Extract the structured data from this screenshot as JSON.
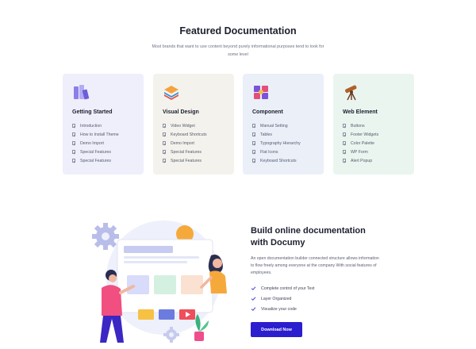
{
  "section": {
    "title": "Featured Documentation",
    "subtitle": "Most brands that want to use content beyond purely informational purposes tend to look for some level"
  },
  "cards": [
    {
      "title": "Getting Started",
      "icon": "book-stack-icon",
      "bg": "#efeefb",
      "items": [
        "Introduction",
        "How to Install Theme",
        "Demo Import",
        "Special Features",
        "Special Features"
      ]
    },
    {
      "title": "Visual Design",
      "icon": "layers-icon",
      "bg": "#f4f2ec",
      "items": [
        "Video Widget",
        "Keyboard Shortcuts",
        "Demo Import",
        "Special Features",
        "Special Features"
      ]
    },
    {
      "title": "Component",
      "icon": "cube-blocks-icon",
      "bg": "#eaeff8",
      "items": [
        "Manual Setting",
        "Tables",
        "Typography Hierarchy",
        "Flat Icons",
        "Keyboard Shortcuts"
      ]
    },
    {
      "title": "Web Element",
      "icon": "telescope-icon",
      "bg": "#eaf5ef",
      "items": [
        "Buttons",
        "Footer Widgets",
        "Color Palette",
        "WP Form",
        "Alert Popup"
      ]
    }
  ],
  "build": {
    "title_line1": "Build online documentation",
    "title_line2": "with Documy",
    "description": "An open documentation builder connected structure allows information to flow freely among everyone at the company With social features of employees.",
    "features": [
      "Complete control of your Text",
      "Layer Organized",
      "Visualize your code"
    ],
    "button_label": "Download Now"
  },
  "colors": {
    "accent": "#2b1ecf",
    "check": "#4a4fd8"
  }
}
